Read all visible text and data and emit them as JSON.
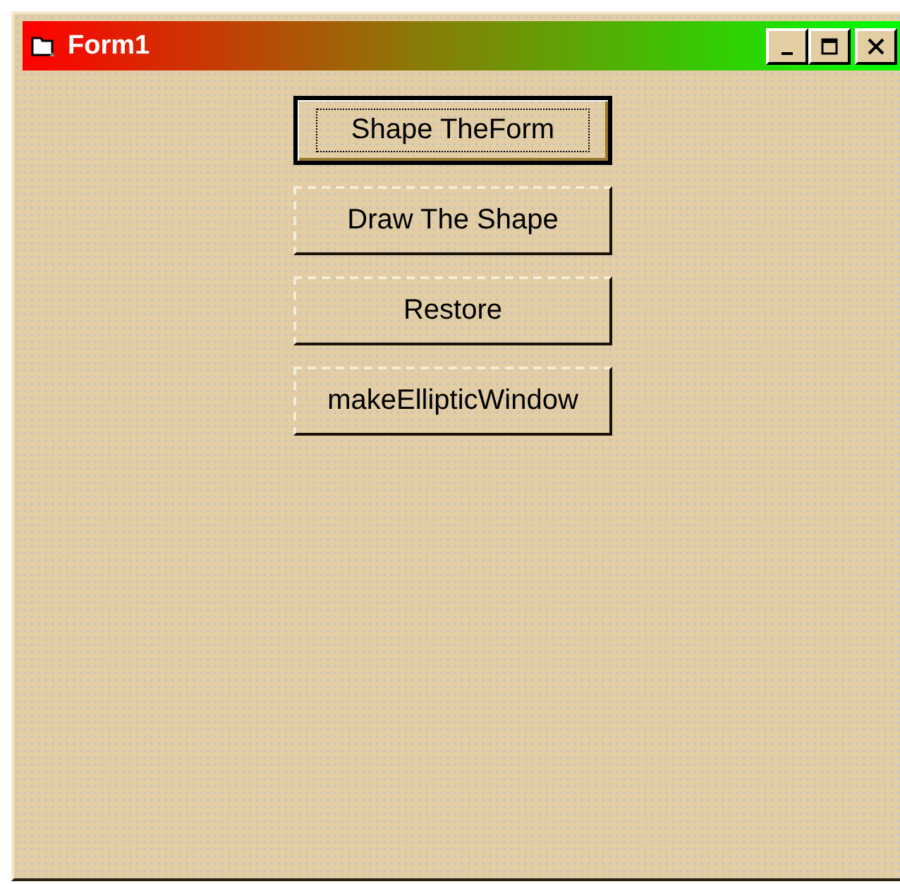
{
  "window": {
    "title": "Form1"
  },
  "buttons": [
    {
      "label": "Shape TheForm",
      "selected": true
    },
    {
      "label": "Draw The Shape",
      "selected": false
    },
    {
      "label": "Restore",
      "selected": false
    },
    {
      "label": "makeEllipticWindow",
      "selected": false
    }
  ]
}
